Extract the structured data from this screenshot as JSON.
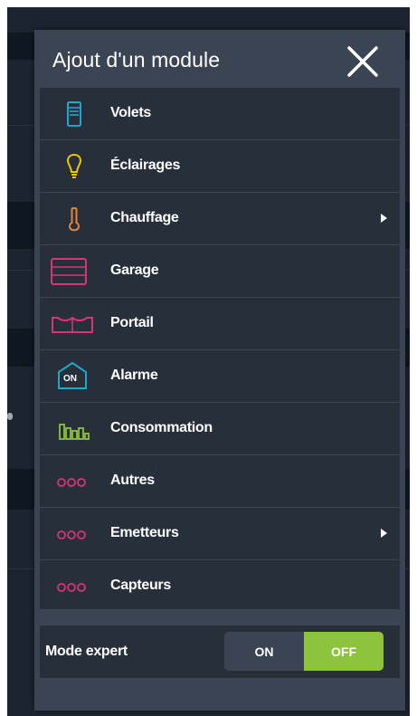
{
  "modal": {
    "title": "Ajout d'un module",
    "close_icon": "close-icon"
  },
  "items": [
    {
      "label": "Volets",
      "icon": "shutter-icon",
      "color": "#1fa7c9",
      "submenu": false
    },
    {
      "label": "Éclairages",
      "icon": "lightbulb-icon",
      "color": "#f2c400",
      "submenu": false
    },
    {
      "label": "Chauffage",
      "icon": "thermometer-icon",
      "color": "#e8833a",
      "submenu": true
    },
    {
      "label": "Garage",
      "icon": "garage-door-icon",
      "color": "#d9337a",
      "submenu": false
    },
    {
      "label": "Portail",
      "icon": "gate-icon",
      "color": "#d9337a",
      "submenu": false
    },
    {
      "label": "Alarme",
      "icon": "alarm-icon",
      "color": "#1fa7c9",
      "submenu": false
    },
    {
      "label": "Consommation",
      "icon": "consumption-icon",
      "color": "#8cc43c",
      "submenu": false
    },
    {
      "label": "Autres",
      "icon": "dots-icon",
      "color": "#d9337a",
      "submenu": false
    },
    {
      "label": "Emetteurs",
      "icon": "dots-icon",
      "color": "#d9337a",
      "submenu": true
    },
    {
      "label": "Capteurs",
      "icon": "dots-icon",
      "color": "#d9337a",
      "submenu": false
    }
  ],
  "alarm_badge": "ON",
  "mode": {
    "label": "Mode expert",
    "on_label": "ON",
    "off_label": "OFF",
    "selected": "OFF",
    "selected_color": "#8cc43c"
  }
}
